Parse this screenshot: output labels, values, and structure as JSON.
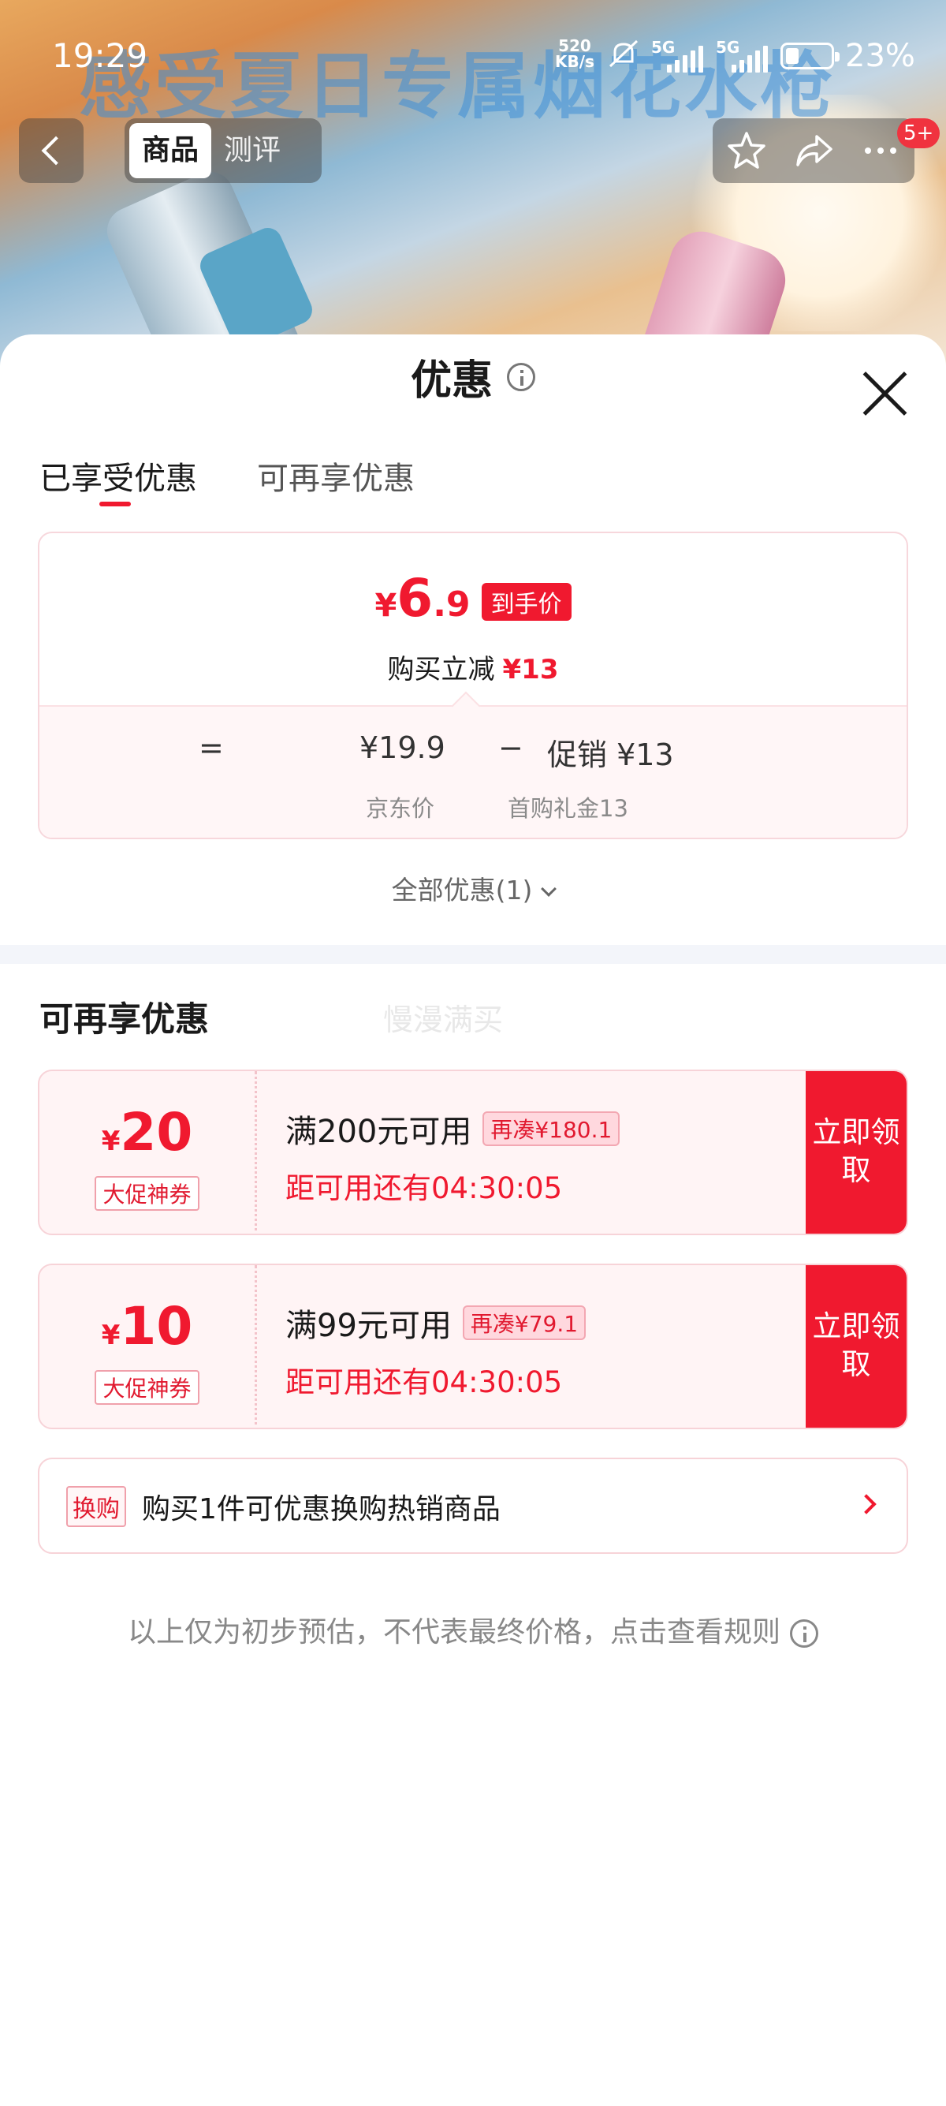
{
  "status_bar": {
    "time": "19:29",
    "net_speed_top": "520",
    "net_speed_unit": "KB/s",
    "sim1": "5G",
    "sim2": "5G",
    "battery": "23%"
  },
  "banner": {
    "headline": "感受夏日专属烟花水枪"
  },
  "top_nav": {
    "tabs": [
      {
        "label": "商品"
      },
      {
        "label": "测评"
      }
    ],
    "badge": "5+"
  },
  "sheet": {
    "title": "优惠",
    "tabs": [
      {
        "label": "已享受优惠"
      },
      {
        "label": "可再享优惠"
      }
    ],
    "enjoyed": {
      "currency": "¥",
      "price_int": "6",
      "price_dec": ".9",
      "price_tag": "到手价",
      "reduce_label": "购买立减",
      "reduce_value": "¥13",
      "eq": "=",
      "jd_price": "¥19.9",
      "minus": "−",
      "promo": "促销 ¥13",
      "jd_price_label": "京东价",
      "promo_label": "首购礼金13"
    },
    "all_offers": "全部优惠(1)",
    "more_title": "可再享优惠",
    "watermark": "慢漫满买",
    "coupons": [
      {
        "currency": "¥",
        "amount": "20",
        "type": "大促神券",
        "condition": "满200元可用",
        "add_more": "再凑¥180.1",
        "remaining": "距可用还有04:30:05",
        "claim": "立即领取"
      },
      {
        "currency": "¥",
        "amount": "10",
        "type": "大促神券",
        "condition": "满99元可用",
        "add_more": "再凑¥79.1",
        "remaining": "距可用还有04:30:05",
        "claim": "立即领取"
      }
    ],
    "swap": {
      "tag": "换购",
      "text": "购买1件可优惠换购热销商品"
    },
    "footer_note": "以上仅为初步预估，不代表最终价格，点击查看规则"
  },
  "colors": {
    "accent": "#f0192f"
  }
}
